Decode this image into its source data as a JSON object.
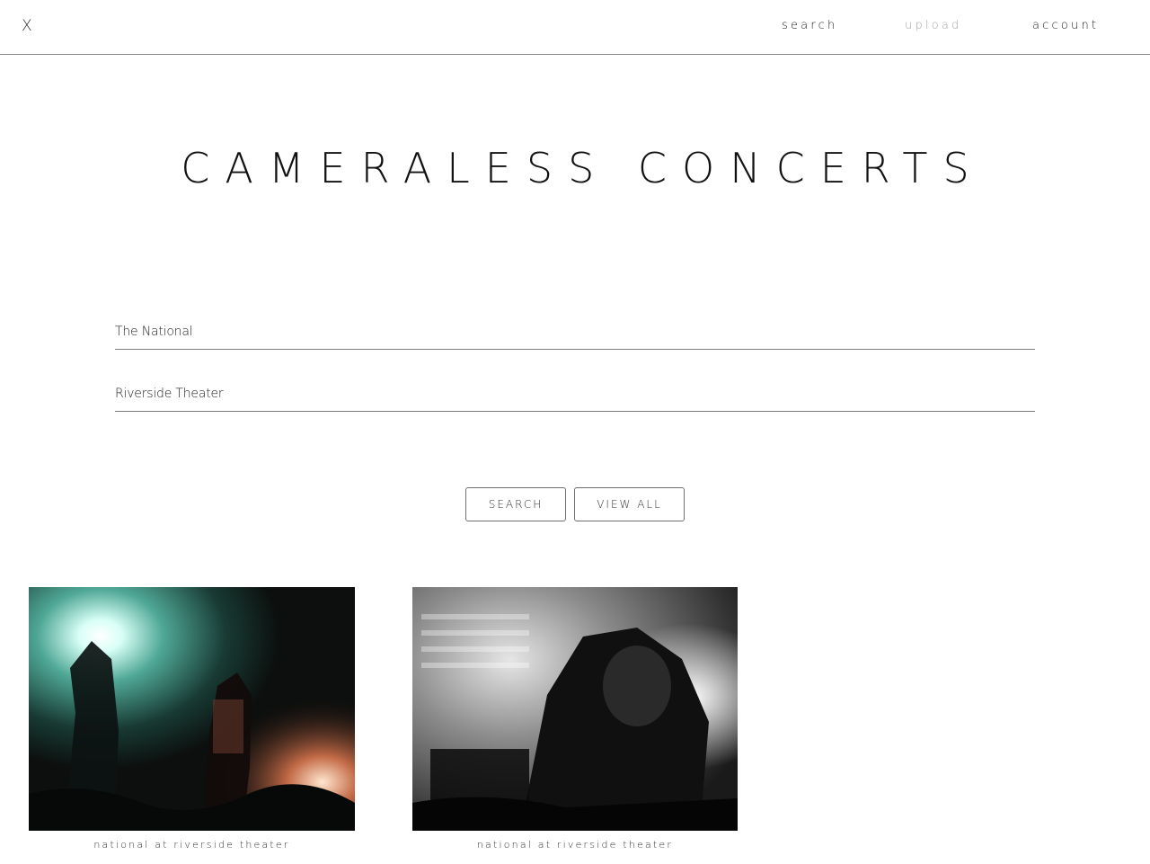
{
  "header": {
    "close_label": "X",
    "nav": {
      "search": "search",
      "upload": "upload",
      "account": "account"
    }
  },
  "main": {
    "title": "CAMERALESS CONCERTS",
    "search_form": {
      "artist_value": "The National",
      "venue_value": "Riverside Theater",
      "search_button": "SEARCH",
      "view_all_button": "VIEW ALL"
    },
    "results": [
      {
        "caption": "national at riverside theater"
      },
      {
        "caption": "national at riverside theater"
      }
    ]
  }
}
